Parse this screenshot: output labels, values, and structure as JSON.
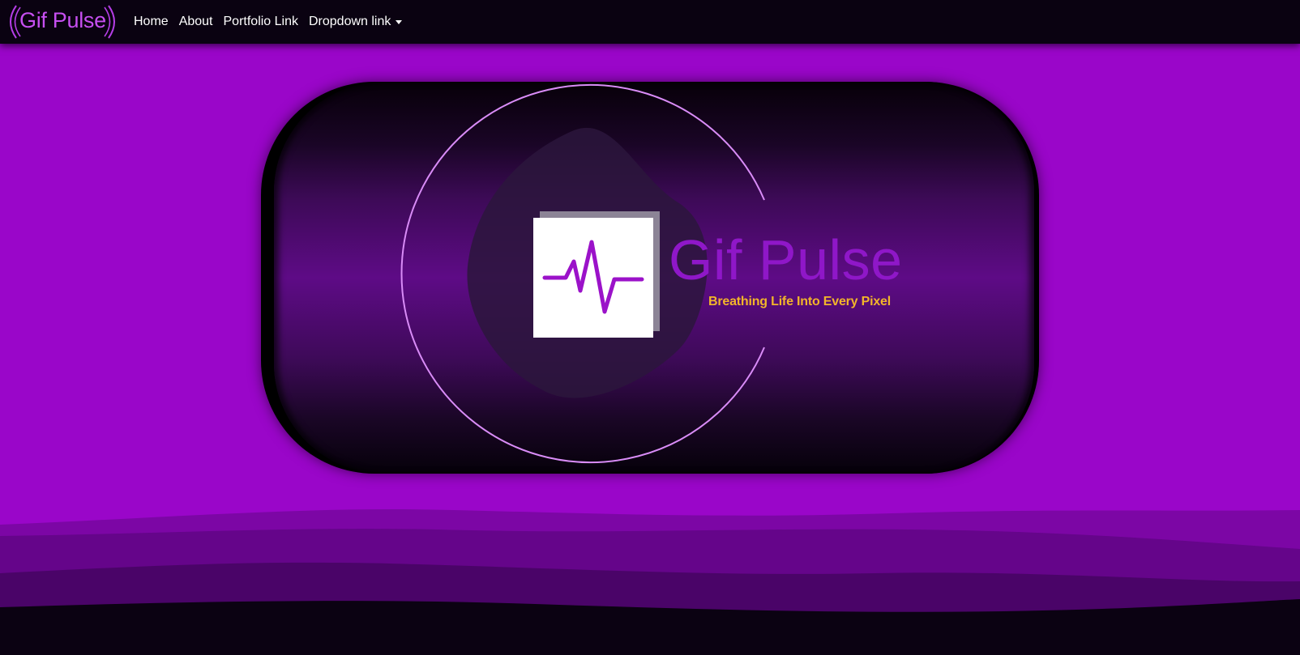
{
  "navbar": {
    "brand": "Gif Pulse",
    "links": [
      {
        "label": "Home"
      },
      {
        "label": "About"
      },
      {
        "label": "Portfolio Link"
      },
      {
        "label": "Dropdown link",
        "has_caret": true
      }
    ]
  },
  "hero": {
    "logo_icon": "heartbeat-pulse-icon",
    "title": "Gif Pulse",
    "tagline": "Breathing Life Into Every Pixel"
  },
  "colors": {
    "background": "#9a06c9",
    "navbar": "#0a0211",
    "brand": "#c64ff0",
    "title": "#8f17c8",
    "tagline": "#f2b52a",
    "ring": "#d98cf7"
  }
}
